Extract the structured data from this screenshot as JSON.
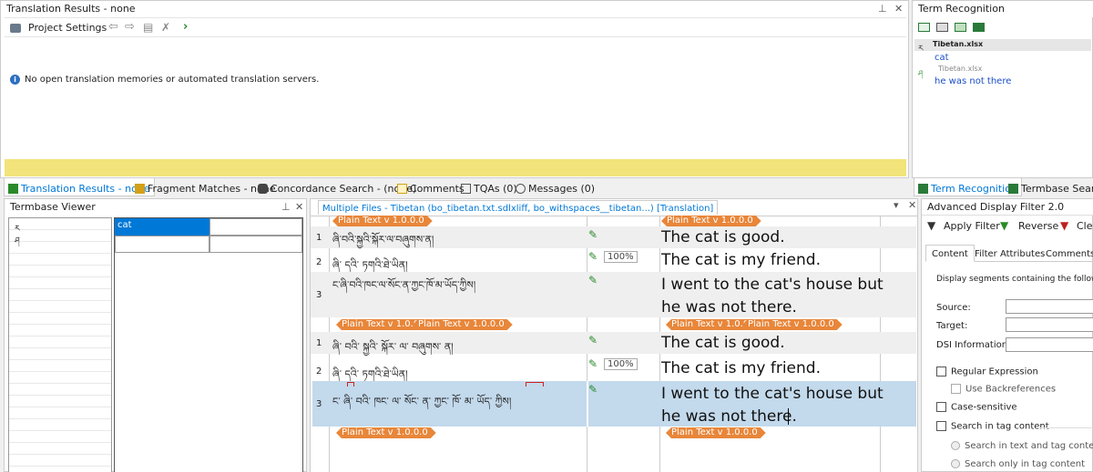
{
  "translation_results": {
    "title": "Translation Results - none",
    "project_settings": "Project Settings",
    "message": "No open translation memories or automated translation servers."
  },
  "bottom_tabs": [
    {
      "label": "Translation Results - none"
    },
    {
      "label": "Fragment Matches - none"
    },
    {
      "label": "Concordance Search - (none)"
    },
    {
      "label": "Comments"
    },
    {
      "label": "TQAs (0)"
    },
    {
      "label": "Messages (0)"
    }
  ],
  "term_recognition": {
    "title": "Term Recognition",
    "entries": [
      {
        "file": "Tibetan.xlsx",
        "term": "cat"
      },
      {
        "file": "Tibetan.xlsx",
        "term": "he was not there"
      }
    ],
    "tabs": [
      "Term Recognition",
      "Termbase Search"
    ]
  },
  "termbase_viewer": {
    "title": "Termbase Viewer",
    "index_letters": [
      "ར",
      "ཤ"
    ],
    "selected_term": "cat"
  },
  "editor": {
    "tab_label": "Multiple Files - Tibetan (bo_tibetan.txt.sdlxliff, bo_withspaces__tibetan...) [Translation]",
    "tag_label": "Plain Text v 1.0.0.0",
    "segments": [
      {
        "num": "1",
        "source": "ཞི་བའི་སྐྱའི་སྐོར་ལ་བཞུགས་ན།",
        "target": "The cat is good.",
        "match": ""
      },
      {
        "num": "2",
        "source": "ཞི་ དའི་ ཏགའི་ཐེ་ཡིན།",
        "target": "The cat is my friend.",
        "match": "100%"
      },
      {
        "num": "3",
        "source": "ང་ཞི་བའི་ཁང་ལ་སོང་ན་ཀྱང་ཁོ་མ་ཡོད་ཀྱིས།",
        "target_line1": "I went to the cat's house but",
        "target_line2": "he was not there.",
        "match": ""
      },
      {
        "num": "1",
        "source": "ཞི་ བའི་ སྐྱའི་ སྐོར་ ལ་ བཞུགས་ ན།",
        "target": "The cat is good.",
        "match": ""
      },
      {
        "num": "2",
        "source": "ཞི་ དའི་ ཏགའི་ཐེ་ཡིན།",
        "target": "The cat is my friend.",
        "match": "100%"
      },
      {
        "num": "3",
        "source": "ང་ ཞི་ བའི་ ཁང་ ལ་ སོང་ ན་ ཀྱང་ ཁོ་ མ་ ཡོད་ ཀྱིས།",
        "target_line1": "I went to the cat's house but",
        "target_line2": "he was not there.",
        "match": ""
      }
    ]
  },
  "filter": {
    "title": "Advanced Display Filter 2.0",
    "apply": "Apply Filter",
    "reverse": "Reverse",
    "clear": "Clea",
    "tabs": [
      "Content",
      "Filter Attributes",
      "Comments"
    ],
    "description": "Display segments containing the following",
    "source_label": "Source:",
    "target_label": "Target:",
    "dsi_label": "DSI Information:",
    "regex": "Regular Expression",
    "backrefs": "Use Backreferences",
    "case": "Case-sensitive",
    "tag_search": "Search in tag content",
    "radio1": "Search in text and tag content",
    "radio2": "Search only in tag content"
  },
  "colors": {
    "accent": "#0078d7",
    "tag": "#e8863a",
    "selected_row": "#c3d9ec",
    "yellow_bar": "#f2e37a"
  }
}
